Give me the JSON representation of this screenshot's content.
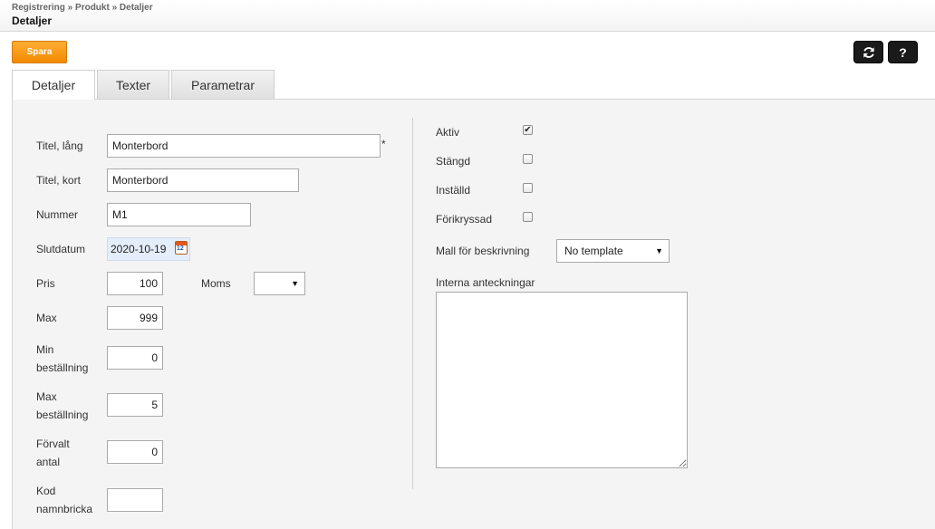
{
  "header": {
    "breadcrumb": "Registrering » Produkt » Detaljer",
    "title": "Detaljer"
  },
  "toolbar": {
    "save_label": "Spara",
    "help_label": "?",
    "refresh_icon": "refresh-icon"
  },
  "tabs": [
    {
      "label": "Detaljer",
      "active": true
    },
    {
      "label": "Texter",
      "active": false
    },
    {
      "label": "Parametrar",
      "active": false
    }
  ],
  "form_left": {
    "title_long": {
      "label": "Titel, lång",
      "value": "Monterbord",
      "required_marker": "*"
    },
    "title_short": {
      "label": "Titel, kort",
      "value": "Monterbord"
    },
    "number": {
      "label": "Nummer",
      "value": "M1"
    },
    "end_date": {
      "label": "Slutdatum",
      "value": "2020-10-19"
    },
    "price": {
      "label": "Pris",
      "value": "100"
    },
    "vat": {
      "label": "Moms",
      "value": ""
    },
    "max": {
      "label": "Max",
      "value": "999"
    },
    "min_order": {
      "label_line1": "Min",
      "label_line2": "beställning",
      "value": "0"
    },
    "max_order": {
      "label_line1": "Max",
      "label_line2": "beställning",
      "value": "5"
    },
    "default_qty": {
      "label_line1": "Förvalt",
      "label_line2": "antal",
      "value": "0"
    },
    "badge_code": {
      "label_line1": "Kod",
      "label_line2": "namnbricka",
      "value": ""
    }
  },
  "form_right": {
    "active": {
      "label": "Aktiv",
      "checked": true
    },
    "closed": {
      "label": "Stängd",
      "checked": false
    },
    "cancelled": {
      "label": "Inställd",
      "checked": false
    },
    "preselected": {
      "label": "Förikryssad",
      "checked": false
    },
    "template": {
      "label": "Mall för beskrivning",
      "value": "No template"
    },
    "notes": {
      "label": "Interna anteckningar",
      "value": ""
    }
  },
  "colors": {
    "accent": "#f59a0c",
    "panel": "#f4f4f4",
    "dark_button": "#1a1a1a"
  }
}
